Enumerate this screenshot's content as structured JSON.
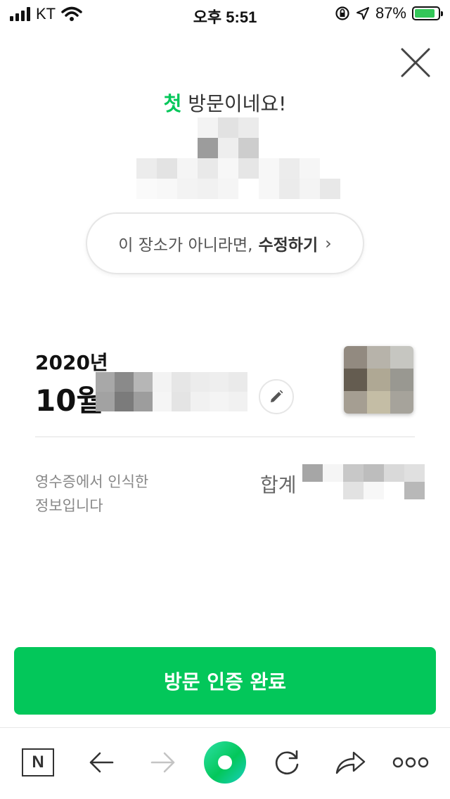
{
  "status_bar": {
    "carrier": "KT",
    "time": "오후 5:51",
    "battery_percent": "87%",
    "battery_level": 0.87,
    "icons": [
      "signal-icon",
      "wifi-icon",
      "orientation-lock-icon",
      "location-icon",
      "battery-charging-icon"
    ]
  },
  "header": {
    "accent_word": "첫",
    "rest_text": " 방문이네요!",
    "accent_color": "#03c75a"
  },
  "place_edit": {
    "prefix": "이 장소가 아니라면,",
    "action": "수정하기",
    "chevron": "›"
  },
  "receipt": {
    "year": "2020년",
    "month": "10월",
    "ocr_note_line1": "영수증에서 인식한",
    "ocr_note_line2": "정보입니다",
    "total_label": "합계"
  },
  "confirm_button": {
    "label": "방문 인증 완료",
    "color": "#03c75a"
  },
  "toolbar": {
    "icons": [
      "naver-home-icon",
      "back-arrow-icon",
      "forward-arrow-icon",
      "green-dot-icon",
      "reload-icon",
      "share-icon",
      "more-icon"
    ],
    "naver_letter": "N"
  }
}
